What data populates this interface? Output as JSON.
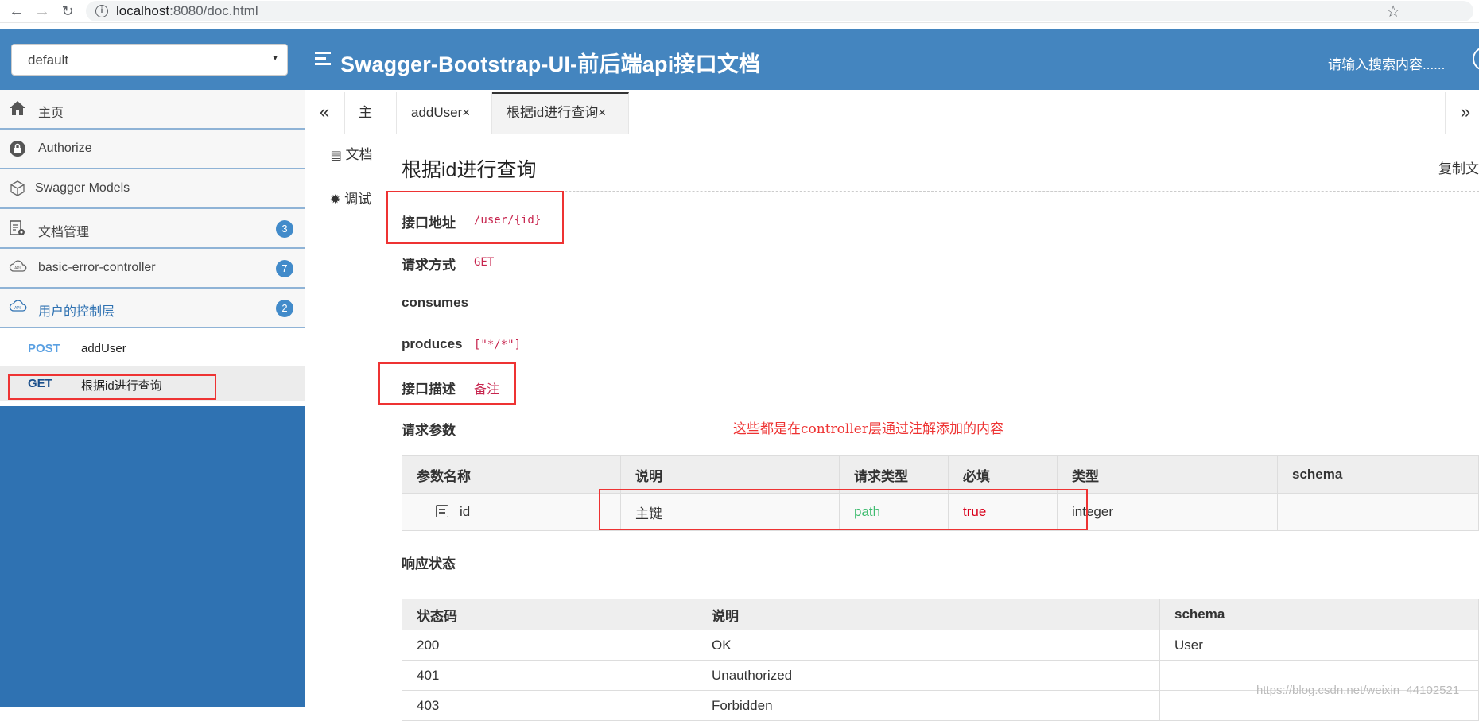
{
  "browser": {
    "url_host": "localhost",
    "url_rest": ":8080/doc.html"
  },
  "header": {
    "group_select_value": "default",
    "title": "Swagger-Bootstrap-UI-前后端api接口文档",
    "search_placeholder": "请输入搜索内容......"
  },
  "sidebar": {
    "items": [
      {
        "label": "主页",
        "icon": "home-icon"
      },
      {
        "label": "Authorize",
        "icon": "lock-icon"
      },
      {
        "label": "Swagger Models",
        "icon": "cube-icon"
      },
      {
        "label": "文档管理",
        "icon": "doc-settings-icon",
        "badge": "3"
      },
      {
        "label": "basic-error-controller",
        "icon": "cloud-api-icon",
        "badge": "7"
      },
      {
        "label": "用户的控制层",
        "icon": "cloud-api-icon",
        "badge": "2"
      }
    ],
    "apis": [
      {
        "method": "POST",
        "name": "addUser"
      },
      {
        "method": "GET",
        "name": "根据id进行查询"
      }
    ]
  },
  "tabs": [
    {
      "label": "主页"
    },
    {
      "label": "addUser×"
    },
    {
      "label": "根据id进行查询×"
    }
  ],
  "subtabs": {
    "doc": "文档",
    "debug": "调试"
  },
  "doc": {
    "title": "根据id进行查询",
    "copy_label": "复制文",
    "address_label": "接口地址",
    "address_value": "/user/{id}",
    "method_label": "请求方式",
    "method_value": "GET",
    "consumes_label": "consumes",
    "produces_label": "produces",
    "produces_value": "[\"*/*\"]",
    "desc_label": "接口描述",
    "desc_value": "备注",
    "params_label": "请求参数",
    "annotation": "这些都是在controller层通过注解添加的内容",
    "param_headers": [
      "参数名称",
      "说明",
      "请求类型",
      "必填",
      "类型",
      "schema"
    ],
    "param_rows": [
      {
        "name": "id",
        "desc": "主键",
        "in": "path",
        "required": "true",
        "type": "integer",
        "schema": ""
      }
    ],
    "response_label": "响应状态",
    "resp_headers": [
      "状态码",
      "说明",
      "schema"
    ],
    "resp_rows": [
      {
        "code": "200",
        "desc": "OK",
        "schema": "User"
      },
      {
        "code": "401",
        "desc": "Unauthorized",
        "schema": ""
      },
      {
        "code": "403",
        "desc": "Forbidden",
        "schema": ""
      }
    ],
    "colors": {
      "path": "#3dbb6e",
      "required": "#d9001b",
      "annotation": "#e33333",
      "code_red": "#c7254e"
    }
  },
  "watermark": "https://blog.csdn.net/weixin_44102521"
}
